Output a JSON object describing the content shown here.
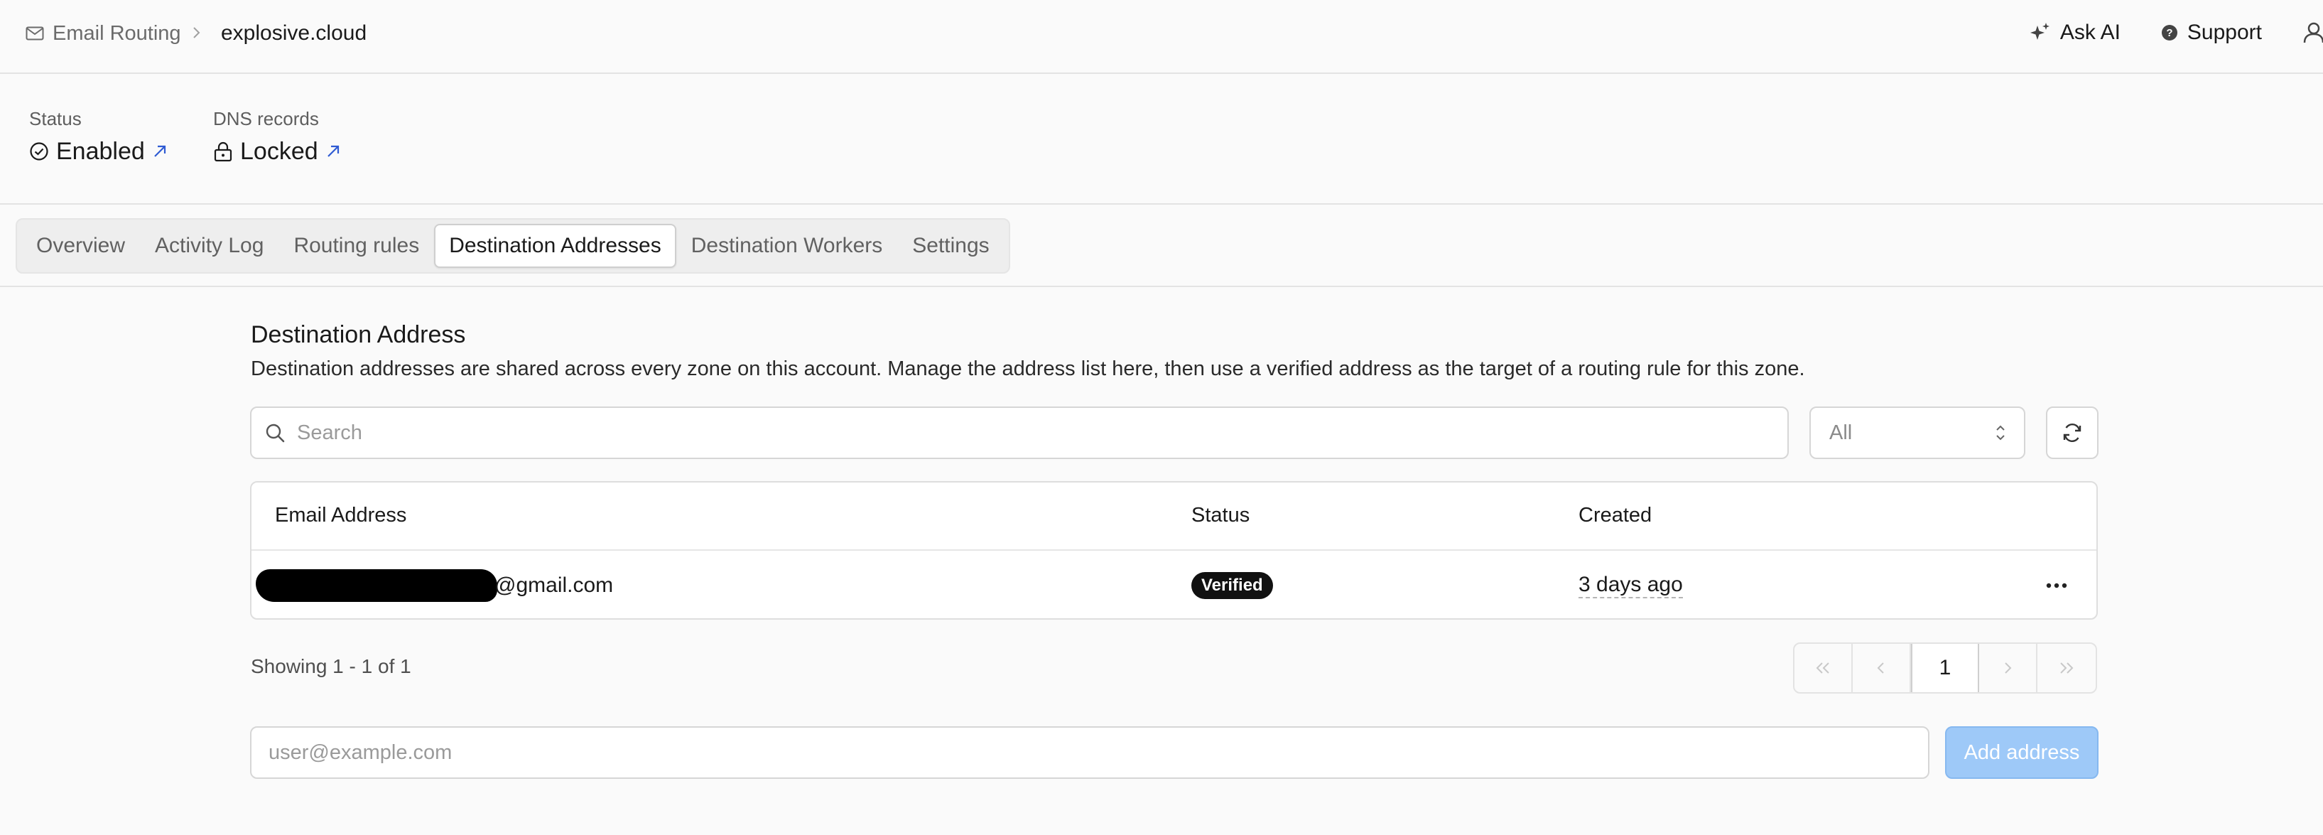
{
  "breadcrumb": {
    "app_icon": "mail-icon",
    "app_label": "Email Routing",
    "separator_icon": "chevron-right-icon",
    "current": "explosive.cloud"
  },
  "header_actions": {
    "ask_ai_icon": "sparkle-icon",
    "ask_ai_label": "Ask AI",
    "support_icon": "help-circle-icon",
    "support_label": "Support",
    "user_icon": "user-icon"
  },
  "status": {
    "status_label": "Status",
    "status_value": "Enabled",
    "status_icon": "check-circle-icon",
    "dns_label": "DNS records",
    "dns_value": "Locked",
    "dns_icon": "lock-icon",
    "external_link_icon": "arrow-up-right-icon",
    "link_color": "#2f5bd3"
  },
  "tabs": [
    {
      "label": "Overview",
      "active": false
    },
    {
      "label": "Activity Log",
      "active": false
    },
    {
      "label": "Routing rules",
      "active": false
    },
    {
      "label": "Destination Addresses",
      "active": true
    },
    {
      "label": "Destination Workers",
      "active": false
    },
    {
      "label": "Settings",
      "active": false
    }
  ],
  "section": {
    "title": "Destination Address",
    "description": "Destination addresses are shared across every zone on this account. Manage the address list here, then use a verified address as the target of a routing rule for this zone."
  },
  "search": {
    "placeholder": "Search",
    "value": "",
    "icon": "search-icon"
  },
  "filter": {
    "selected": "All",
    "icon": "chevron-up-down-icon"
  },
  "refresh": {
    "icon": "refresh-icon"
  },
  "table": {
    "columns": [
      "Email Address",
      "Status",
      "Created"
    ],
    "rows": [
      {
        "email_visible": "@gmail.com",
        "email_redacted": true,
        "status": "Verified",
        "created": "3 days ago",
        "menu_icon": "more-horizontal-icon"
      }
    ]
  },
  "pagination": {
    "summary": "Showing 1 - 1 of 1",
    "current_page": "1",
    "first_icon": "chevrons-left-icon",
    "prev_icon": "chevron-left-icon",
    "next_icon": "chevron-right-icon",
    "last_icon": "chevrons-right-icon"
  },
  "add_address": {
    "placeholder": "user@example.com",
    "value": "",
    "button_label": "Add address",
    "button_color": "#9ec9f8"
  }
}
